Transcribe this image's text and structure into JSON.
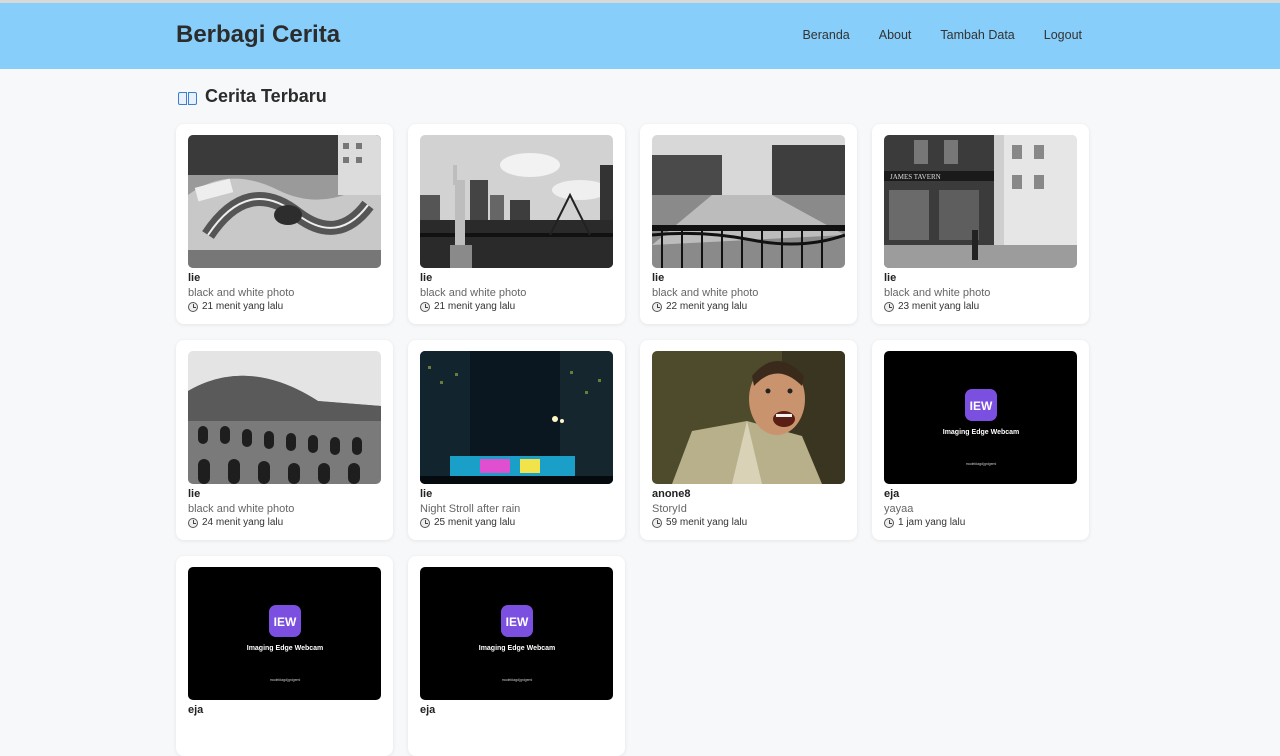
{
  "app": {
    "brand": "Berbagi Cerita",
    "nav": [
      "Beranda",
      "About",
      "Tambah Data",
      "Logout"
    ]
  },
  "section": {
    "icon": "open-book-icon",
    "title": "Cerita Terbaru"
  },
  "stories": [
    {
      "name": "lie",
      "description": "black and white photo",
      "time": "21 menit yang lalu",
      "image": "monaco-circuit-bw"
    },
    {
      "name": "lie",
      "description": "black and white photo",
      "time": "21 menit yang lalu",
      "image": "new-york-liberty-bw"
    },
    {
      "name": "lie",
      "description": "black and white photo",
      "time": "22 menit yang lalu",
      "image": "amsterdam-canal-bw"
    },
    {
      "name": "lie",
      "description": "black and white photo",
      "time": "23 menit yang lalu",
      "image": "london-tavern-bw"
    },
    {
      "name": "lie",
      "description": "black and white photo",
      "time": "24 menit yang lalu",
      "image": "colosseum-bw"
    },
    {
      "name": "lie",
      "description": "Night Stroll after rain",
      "time": "25 menit yang lalu",
      "image": "city-night"
    },
    {
      "name": "anone8",
      "description": "StoryId",
      "time": "59 menit yang lalu",
      "image": "man-shouting"
    },
    {
      "name": "eja",
      "description": "yayaa",
      "time": "1 jam yang lalu",
      "image": "imaging-edge-webcam"
    },
    {
      "name": "eja",
      "description": "",
      "time": "",
      "image": "imaging-edge-webcam"
    },
    {
      "name": "eja",
      "description": "",
      "time": "",
      "image": "imaging-edge-webcam"
    }
  ],
  "webcam_logo": {
    "badge": "IEW",
    "title": "Imaging Edge Webcam",
    "subtitle": "model#agd|gnigeml"
  },
  "colors": {
    "header_bg": "#87cefa",
    "page_bg": "#f7f8fa",
    "logo_purple": "#7b4fe0"
  }
}
